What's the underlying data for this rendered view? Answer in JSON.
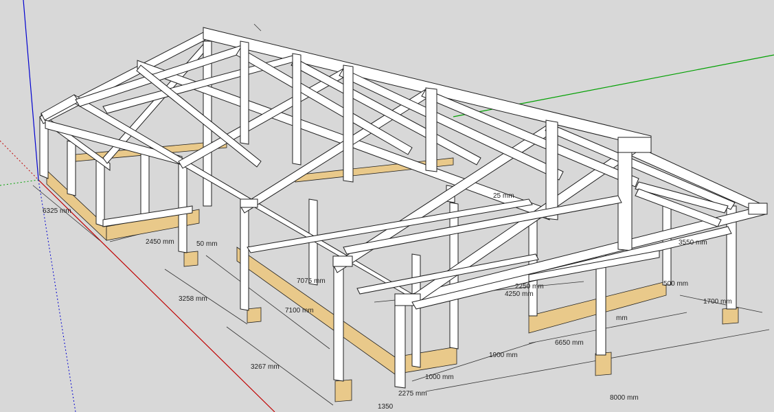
{
  "colors": {
    "background": "#d8d8d8",
    "timber": "#ffffff",
    "timber_edge": "#1e1e1e",
    "plinth": "#e9c98a",
    "axis_red": "#c00000",
    "axis_green": "#00a000",
    "axis_blue": "#0000d0"
  },
  "dimensions": [
    {
      "id": "d6325",
      "label": "6325 mm"
    },
    {
      "id": "d2450",
      "label": "2450 mm"
    },
    {
      "id": "d50",
      "label": "50 mm"
    },
    {
      "id": "d3258",
      "label": "3258 mm"
    },
    {
      "id": "d7075",
      "label": "7075 mm"
    },
    {
      "id": "d7100",
      "label": "7100 mm"
    },
    {
      "id": "d3267",
      "label": "3267 mm"
    },
    {
      "id": "d1350",
      "label": "1350"
    },
    {
      "id": "d2275",
      "label": "2275 mm"
    },
    {
      "id": "d1000",
      "label": "1000 mm"
    },
    {
      "id": "d1900",
      "label": "1900 mm"
    },
    {
      "id": "d6650",
      "label": "6650 mm"
    },
    {
      "id": "d8000",
      "label": "8000 mm"
    },
    {
      "id": "d4250",
      "label": "4250 mm"
    },
    {
      "id": "d2250",
      "label": "2250 mm"
    },
    {
      "id": "d500",
      "label": "500 mm"
    },
    {
      "id": "d1700",
      "label": "1700 mm"
    },
    {
      "id": "d3550",
      "label": "3550 mm"
    },
    {
      "id": "d25",
      "label": "25 mm"
    },
    {
      "id": "dmm",
      "label": "mm"
    }
  ]
}
